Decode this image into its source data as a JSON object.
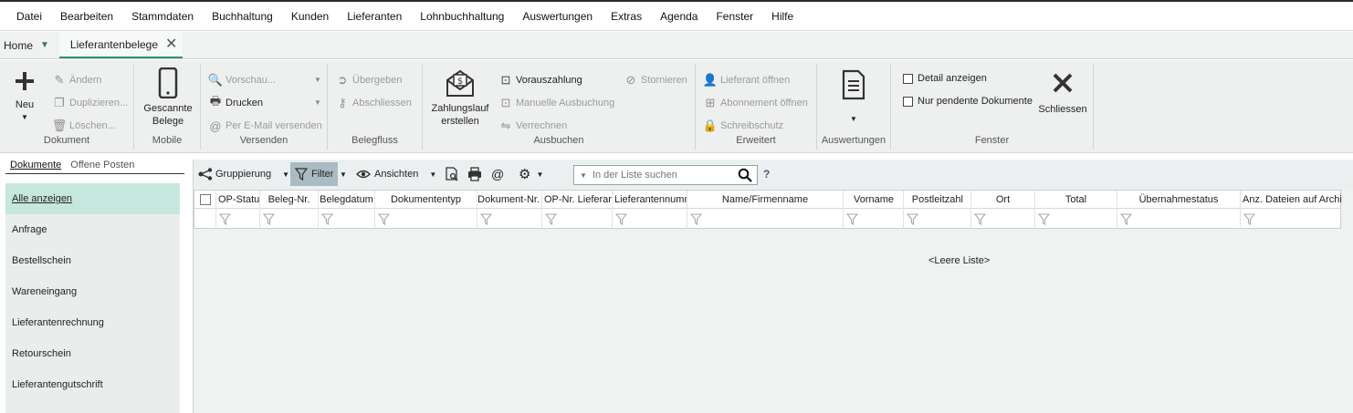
{
  "menu": [
    "Datei",
    "Bearbeiten",
    "Stammdaten",
    "Buchhaltung",
    "Kunden",
    "Lieferanten",
    "Lohnbuchhaltung",
    "Auswertungen",
    "Extras",
    "Agenda",
    "Fenster",
    "Hilfe"
  ],
  "tabs": {
    "home": "Home",
    "active": "Lieferantenbelege"
  },
  "ribbon": {
    "dokument": {
      "label": "Dokument",
      "neu": "Neu",
      "aendern": "Ändern",
      "duplizieren": "Duplizieren...",
      "loeschen": "Löschen..."
    },
    "mobile": {
      "label": "Mobile",
      "gescannte": "Gescannte",
      "belege": "Belege"
    },
    "versenden": {
      "label": "Versenden",
      "vorschau": "Vorschau...",
      "drucken": "Drucken",
      "email": "Per E-Mail versenden"
    },
    "belegfluss": {
      "label": "Belegfluss",
      "uebergeben": "Übergeben",
      "abschliessen": "Abschliessen"
    },
    "ausbuchen": {
      "label": "Ausbuchen",
      "zahlungslauf": "Zahlungslauf",
      "erstellen": "erstellen",
      "vorauszahlung": "Vorauszahlung",
      "manuelle": "Manuelle Ausbuchung",
      "verrechnen": "Verrechnen",
      "stornieren": "Stornieren"
    },
    "erweitert": {
      "label": "Erweitert",
      "lieferant": "Lieferant öffnen",
      "abonnement": "Abonnement öffnen",
      "schreibschutz": "Schreibschutz"
    },
    "auswertungen": {
      "label": "Auswertungen"
    },
    "fenster": {
      "label": "Fenster",
      "detail": "Detail anzeigen",
      "pendent": "Nur pendente Dokumente",
      "schliessen": "Schliessen"
    }
  },
  "left": {
    "tabs": [
      "Dokumente",
      "Offene Posten"
    ],
    "items": [
      "Alle anzeigen",
      "Anfrage",
      "Bestellschein",
      "Wareneingang",
      "Lieferantenrechnung",
      "Retourschein",
      "Lieferantengutschrift"
    ]
  },
  "toolbar": {
    "gruppierung": "Gruppierung",
    "filter": "Filter",
    "ansichten": "Ansichten",
    "search_placeholder": "In der Liste suchen",
    "help": "?"
  },
  "grid": {
    "columns": [
      "OP-Status",
      "Beleg-Nr.",
      "Belegdatum",
      "Dokumententyp",
      "Dokument-Nr.",
      "OP-Nr. Lieferant",
      "Lieferantennummer",
      "Name/Firmenname",
      "Vorname",
      "Postleitzahl",
      "Ort",
      "Total",
      "Übernahmestatus",
      "Anz. Dateien auf Archiv"
    ],
    "empty": "<Leere Liste>"
  },
  "colors": {
    "accent": "#2f8e7d",
    "selected": "#c6e7dd",
    "filter_active": "#a9bcc3"
  }
}
